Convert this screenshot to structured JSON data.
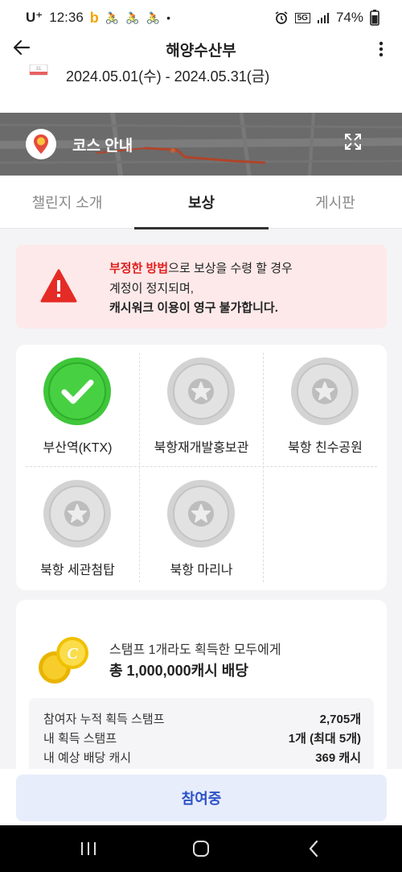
{
  "status_bar": {
    "carrier": "U⁺",
    "time": "12:36",
    "dot": "•",
    "network": "5G",
    "battery": "74%"
  },
  "app_bar": {
    "title": "해양수산부"
  },
  "challenge": {
    "period": "2024.05.01(수) - 2024.05.31(금)"
  },
  "map": {
    "label": "코스 안내"
  },
  "tabs": [
    {
      "label": "챌린지 소개",
      "active": false
    },
    {
      "label": "보상",
      "active": true
    },
    {
      "label": "게시판",
      "active": false
    }
  ],
  "warning": {
    "line1_red": "부정한 방법",
    "line1_rest": "으로 보상을 수령 할 경우",
    "line2": "계정이 정지되며,",
    "line3": "캐시워크 이용이 영구 불가합니다."
  },
  "stamps": [
    {
      "name": "부산역(KTX)",
      "acquired": true
    },
    {
      "name": "북항재개발홍보관",
      "acquired": false
    },
    {
      "name": "북항 친수공원",
      "acquired": false
    },
    {
      "name": "북항 세관첨탑",
      "acquired": false
    },
    {
      "name": "북항 마리나",
      "acquired": false
    }
  ],
  "reward": {
    "subtitle": "스탬프 1개라도 획득한 모두에게",
    "headline": "총 1,000,000캐시 배당",
    "stats": [
      {
        "label": "참여자 누적 획득 스탬프",
        "value": "2,705개"
      },
      {
        "label": "내 획득 스탬프",
        "value": "1개 (최대 5개)"
      },
      {
        "label": "내 예상 배당 캐시",
        "value": "369 캐시"
      }
    ]
  },
  "cta": {
    "label": "참여중"
  },
  "colors": {
    "danger": "#e0201f",
    "warning_bg": "#fde9e9",
    "success": "#3fc63a",
    "cta_text": "#2c53c8",
    "cta_bg": "#e8edfb"
  }
}
